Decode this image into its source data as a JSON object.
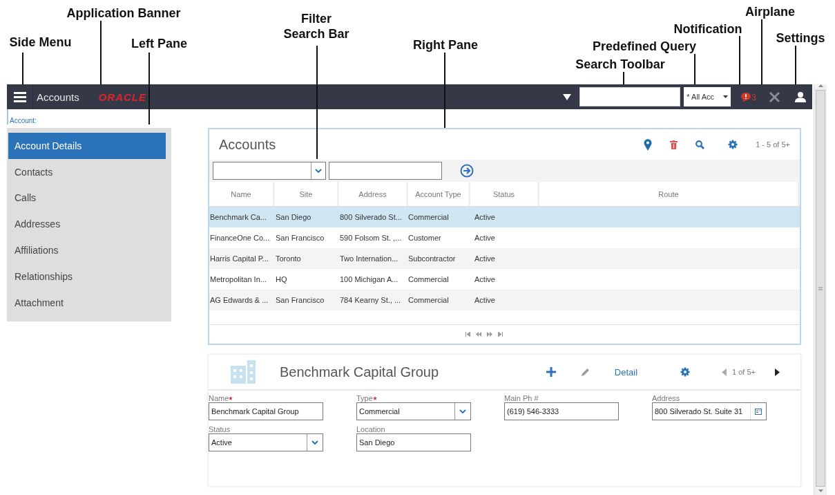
{
  "callouts": [
    {
      "label": "Side Menu"
    },
    {
      "label": "Application Banner"
    },
    {
      "label": "Left Pane"
    },
    {
      "label": "Filter Search Bar"
    },
    {
      "label": "Right Pane"
    },
    {
      "label": "Search Toolbar"
    },
    {
      "label": "Predefined Query"
    },
    {
      "label": "Notification"
    },
    {
      "label": "Airplane"
    },
    {
      "label": "Settings"
    }
  ],
  "banner": {
    "title": "Accounts",
    "logo": "ORACLE",
    "query": "* All Acc",
    "notification_count": "3"
  },
  "breadcrumb": "Account:",
  "left_pane": {
    "items": [
      {
        "label": "Account Details",
        "selected": true
      },
      {
        "label": "Contacts",
        "selected": false
      },
      {
        "label": "Calls",
        "selected": false
      },
      {
        "label": "Addresses",
        "selected": false
      },
      {
        "label": "Affiliations",
        "selected": false
      },
      {
        "label": "Relationships",
        "selected": false
      },
      {
        "label": "Attachment",
        "selected": false
      }
    ]
  },
  "accounts": {
    "title": "Accounts",
    "range": "1 - 5 of 5+",
    "columns": [
      "Name",
      "Site",
      "Address",
      "Account Type",
      "Status",
      "Route"
    ],
    "rows": [
      {
        "cells": [
          "Benchmark Ca...",
          "San Diego",
          "800 Silverado St...",
          "Commercial",
          "Active"
        ],
        "selected": true
      },
      {
        "cells": [
          "FinanceOne Co...",
          "San Francisco",
          "590 Folsom St. ,...",
          "Customer",
          "Active"
        ],
        "selected": false
      },
      {
        "cells": [
          "Harris Capital P...",
          "Toronto",
          "Two Internation...",
          "Subcontractor",
          "Active"
        ],
        "selected": false
      },
      {
        "cells": [
          "Metropolitan In...",
          "HQ",
          "100 Michigan A...",
          "Commercial",
          "Active"
        ],
        "selected": false
      },
      {
        "cells": [
          "AG Edwards & ...",
          "San Francisco",
          "784 Kearny St., ...",
          "Commercial",
          "Active"
        ],
        "selected": false
      }
    ]
  },
  "detail": {
    "title": "Benchmark Capital Group",
    "detail_link": "Detail",
    "pager": "1 of 5+",
    "fields": [
      {
        "label": "Name",
        "required": true,
        "value": "Benchmark Capital Group",
        "kind": "text"
      },
      {
        "label": "Type",
        "required": true,
        "value": "Commercial",
        "kind": "select"
      },
      {
        "label": "Main Ph #",
        "required": false,
        "value": "(619) 546-3333",
        "kind": "text"
      },
      {
        "label": "Address",
        "required": false,
        "value": "800 Silverado St. Suite 31",
        "kind": "lookup"
      },
      {
        "label": "Status",
        "required": false,
        "value": "Active",
        "kind": "select"
      },
      {
        "label": "Location",
        "required": false,
        "value": "San Diego",
        "kind": "text"
      }
    ]
  }
}
